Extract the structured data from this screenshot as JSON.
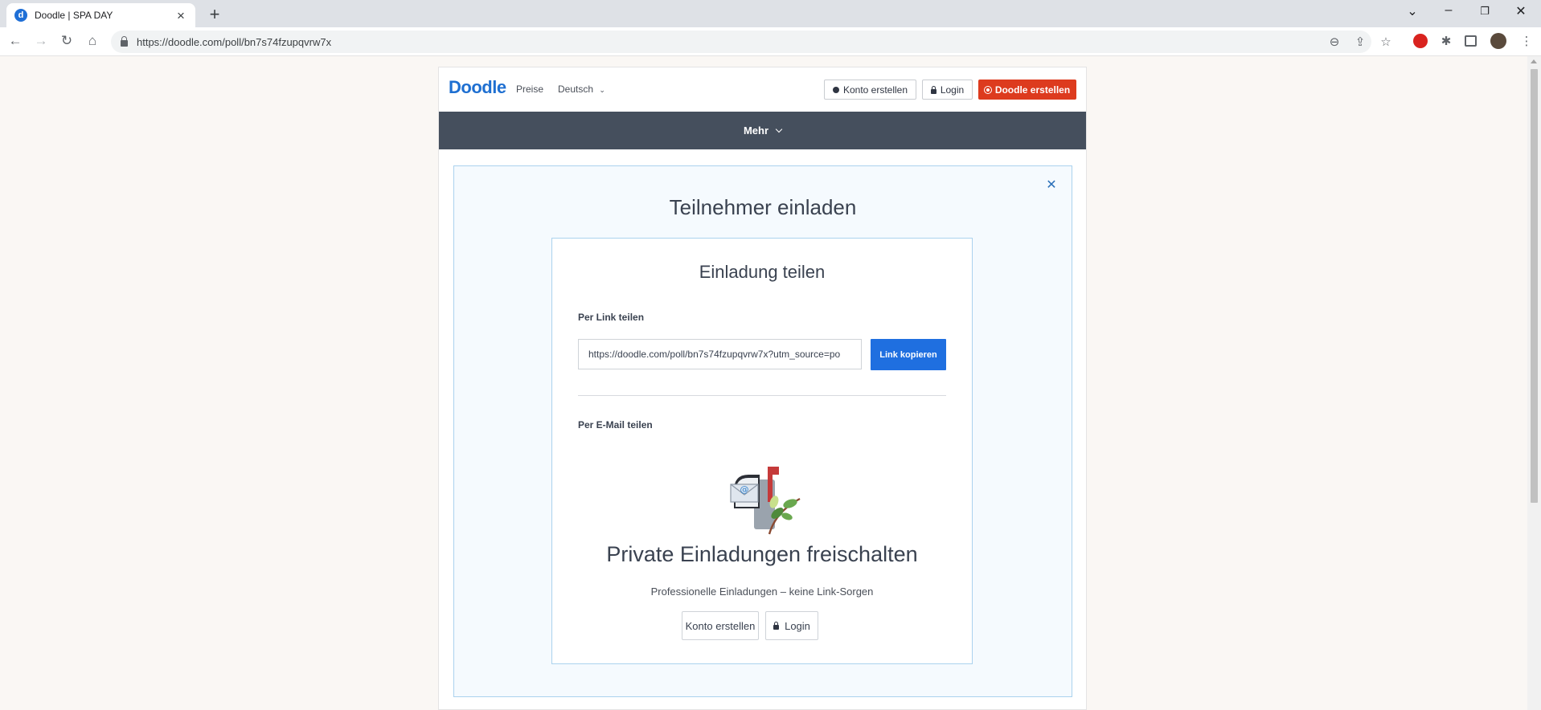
{
  "browser": {
    "tab_title": "Doodle | SPA DAY",
    "favicon_letter": "d",
    "url": "https://doodle.com/poll/bn7s74fzupqvrw7x"
  },
  "header": {
    "logo": "Doodle",
    "pricing": "Preise",
    "language": "Deutsch",
    "create_account": "Konto erstellen",
    "login": "Login",
    "create_doodle": "Doodle erstellen"
  },
  "menubar": {
    "more": "Mehr"
  },
  "invite": {
    "title": "Teilnehmer einladen",
    "close_icon": "close-icon",
    "card_title": "Einladung teilen",
    "link_label": "Per Link teilen",
    "link_value": "https://doodle.com/poll/bn7s74fzupqvrw7x?utm_source=po",
    "copy_button": "Link kopieren",
    "email_label": "Per E-Mail teilen",
    "illustration": "mailbox-icon",
    "promo_title": "Private Einladungen freischalten",
    "promo_subtitle": "Professionelle Einladungen – keine Link-Sorgen",
    "create_account_button": "Konto erstellen",
    "login_button": "Login"
  },
  "colors": {
    "brand_blue": "#1e6fd1",
    "primary_red": "#dd3b1e",
    "menubar": "#454f5d",
    "panel_border": "#abd2ee"
  }
}
